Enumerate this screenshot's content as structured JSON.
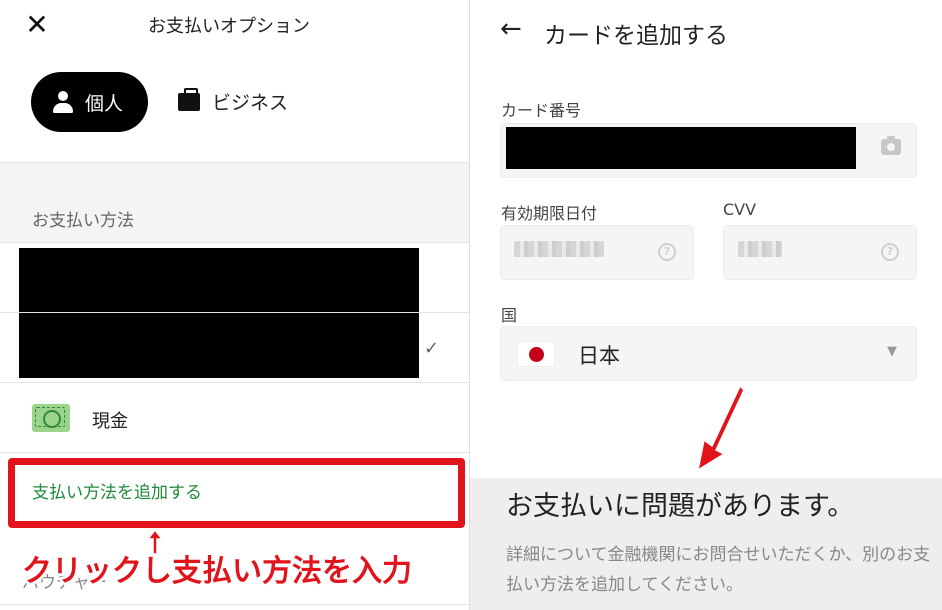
{
  "left": {
    "header": {
      "close": "✕",
      "title": "お支払いオプション"
    },
    "profiles": {
      "personal": "個人",
      "business": "ビジネス"
    },
    "section_label": "お支払い方法",
    "cash_label": "現金",
    "add_payment": "支払い方法を追加する",
    "annotation": "クリックし支払い方法を入力",
    "bottom_partial": "バウチャー"
  },
  "right": {
    "back": "←",
    "title": "カードを追加する",
    "card_number_label": "カード番号",
    "expiry_label": "有効期限日付",
    "cvv_label": "CVV",
    "help": "?",
    "country_label": "国",
    "country_value": "日本",
    "caret": "▼",
    "error_title": "お支払いに問題があります。",
    "error_message": "詳細について金融機関にお問合せいただくか、別のお支払い方法を追加してください。"
  },
  "colors": {
    "highlight_red": "#e0141a",
    "link_green": "#1f8a3a"
  }
}
